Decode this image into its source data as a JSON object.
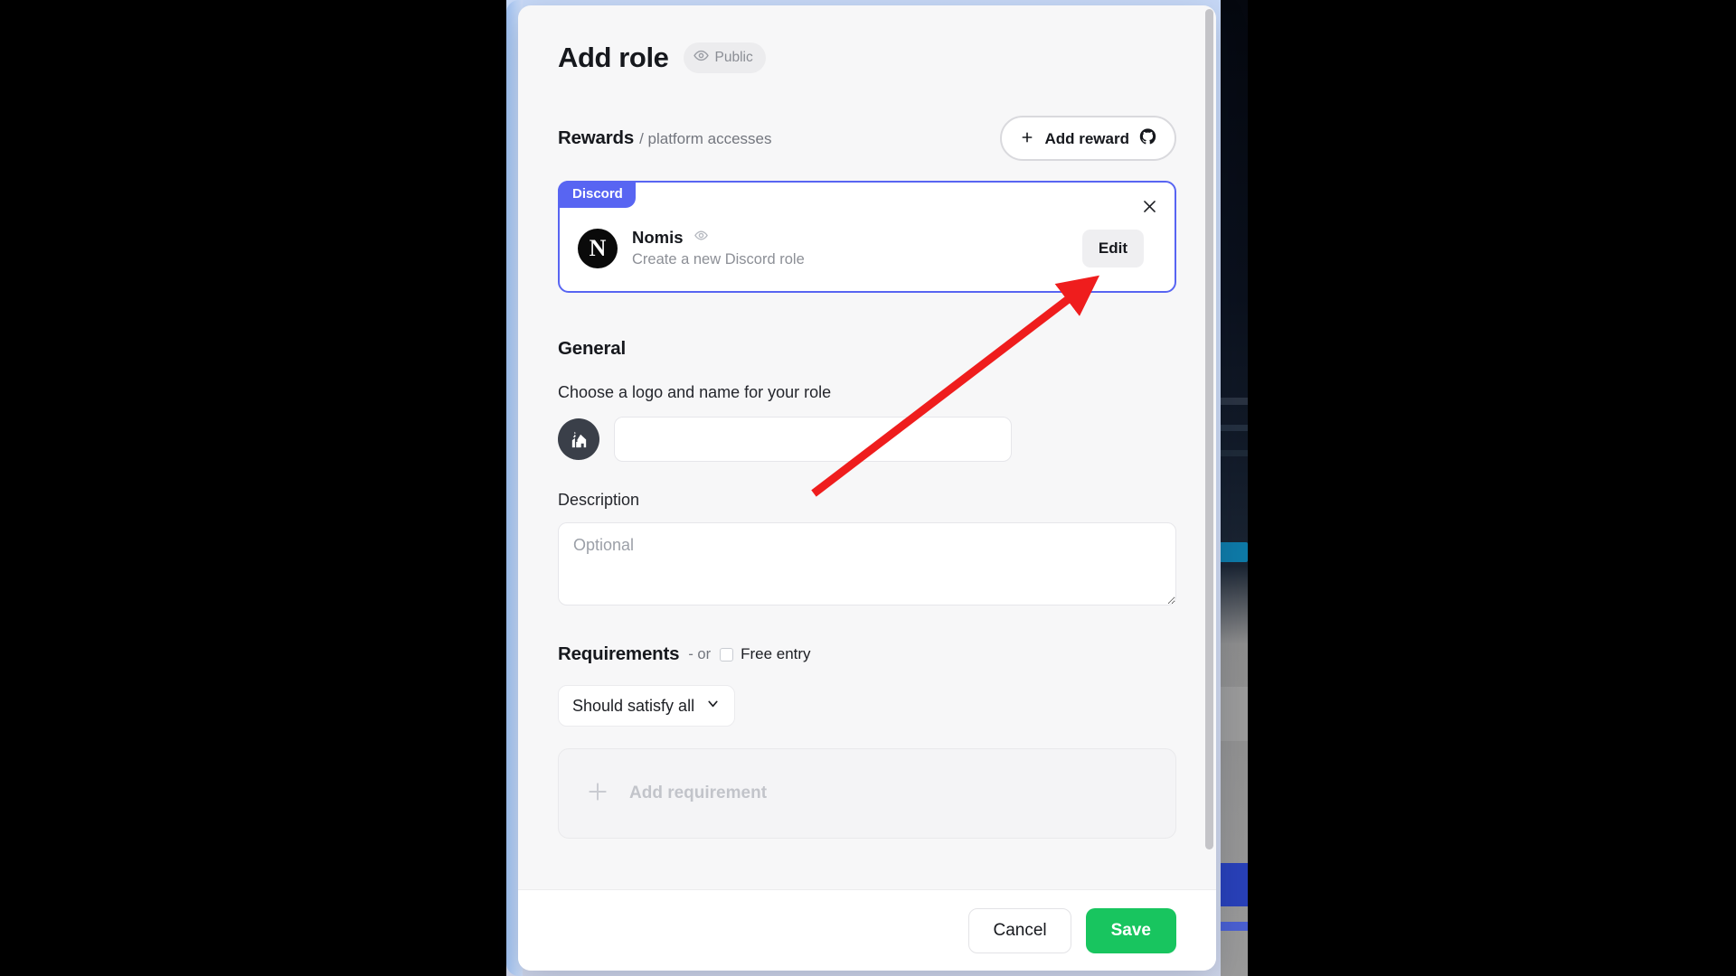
{
  "modal": {
    "title": "Add role",
    "visibility_badge": {
      "label": "Public",
      "icon": "eye-icon"
    }
  },
  "rewards": {
    "heading": "Rewards",
    "subheading": "/ platform accesses",
    "add_button": {
      "label": "Add reward",
      "left_icon": "plus-icon",
      "right_icon": "github-icon"
    },
    "card": {
      "platform_tag": "Discord",
      "close_icon": "close-icon",
      "avatar_letter": "N",
      "name": "Nomis",
      "name_icon": "eye-icon",
      "description": "Create a new Discord role",
      "edit_label": "Edit"
    }
  },
  "general": {
    "heading": "General",
    "logo_name_label": "Choose a logo and name for your role",
    "logo_icon": "house-icon",
    "name_input_value": "",
    "name_input_placeholder": "",
    "description_label": "Description",
    "description_value": "",
    "description_placeholder": "Optional"
  },
  "requirements": {
    "heading": "Requirements",
    "or_text": "- or",
    "free_entry_label": "Free entry",
    "free_entry_checked": false,
    "logic_select_value": "Should satisfy all",
    "logic_select_icon": "chevron-down-icon",
    "add_requirement_label": "Add requirement",
    "add_requirement_icon": "plus-icon"
  },
  "footer": {
    "cancel_label": "Cancel",
    "save_label": "Save"
  },
  "colors": {
    "discord_accent": "#5865f2",
    "save_green": "#18c55f",
    "annotation_red": "#ef1d1d",
    "backdrop_blue": "#cddcf6"
  }
}
